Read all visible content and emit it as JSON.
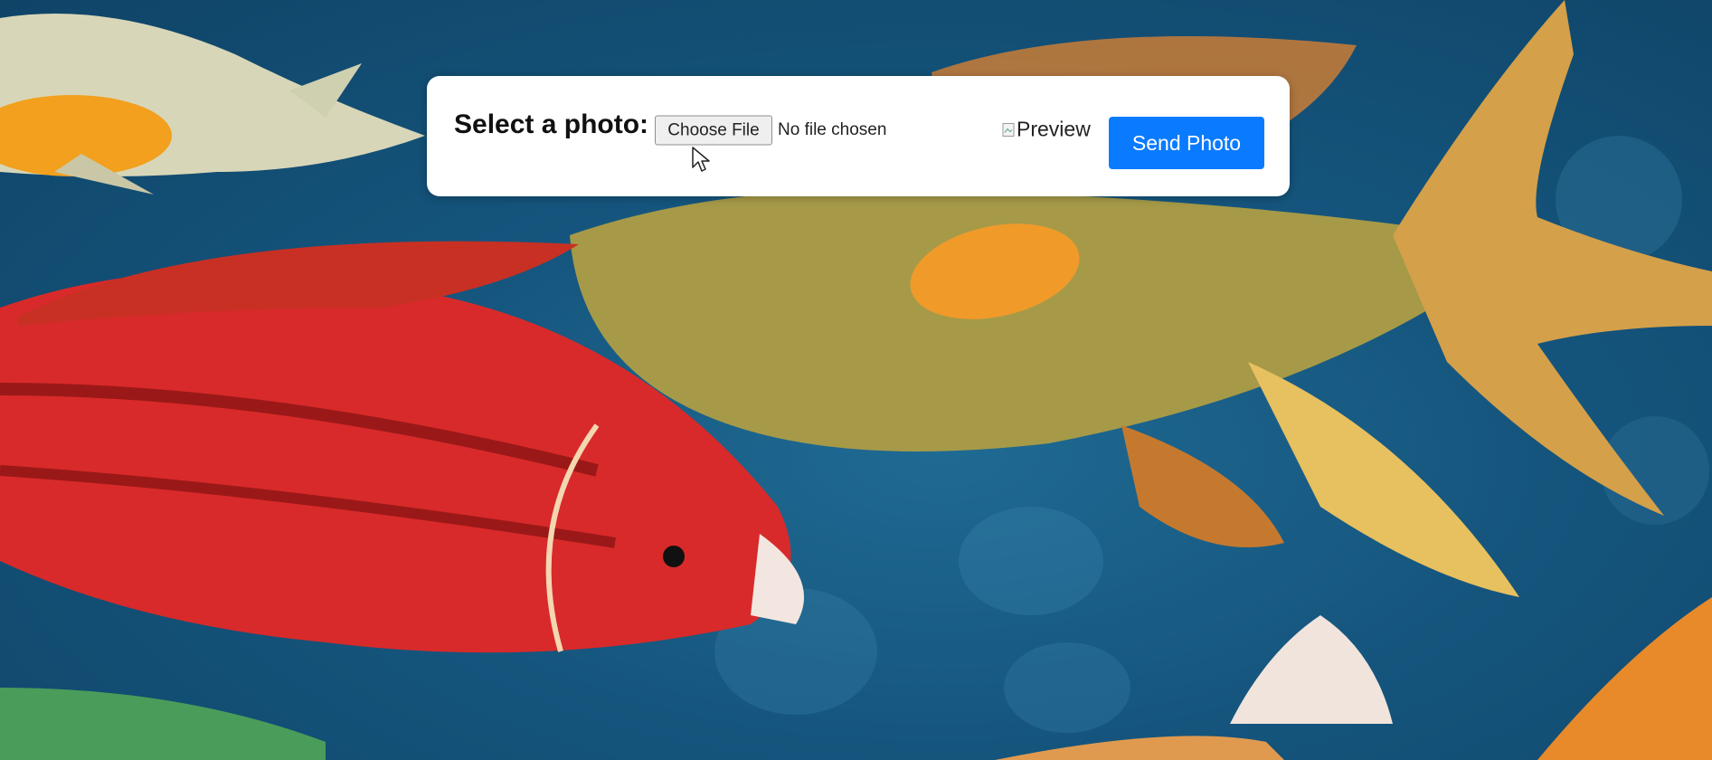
{
  "form": {
    "label": "Select a photo:",
    "file_button_label": "Choose File",
    "file_status": "No file chosen",
    "preview_alt": "Preview",
    "send_button_label": "Send Photo"
  },
  "colors": {
    "send_button": "#0a7bff",
    "panel": "#ffffff",
    "water": "#15557d"
  },
  "icons": {
    "cursor": "mouse-pointer-icon",
    "preview": "broken-image-icon"
  }
}
